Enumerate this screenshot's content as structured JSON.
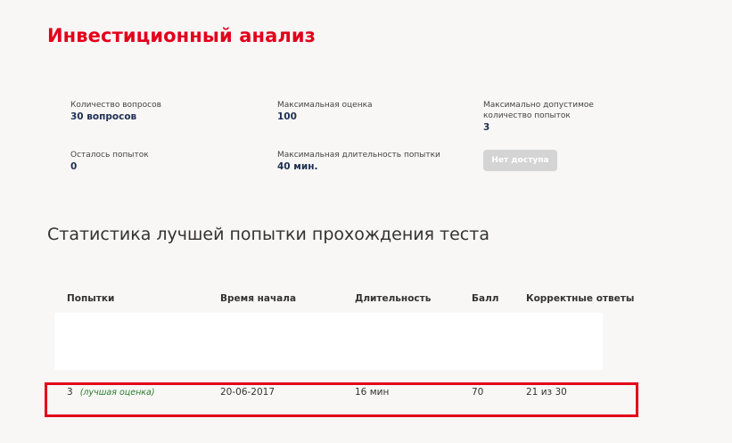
{
  "page": {
    "title": "Инвестиционный анализ"
  },
  "info": {
    "questions_label": "Количество вопросов",
    "questions_value": "30 вопросов",
    "max_score_label": "Максимальная оценка",
    "max_score_value": "100",
    "max_attempts_label": "Максимально допустимое количество попыток",
    "max_attempts_value": "3",
    "attempts_left_label": "Осталось попыток",
    "attempts_left_value": "0",
    "max_duration_label": "Максимальная длительность попытки",
    "max_duration_value": "40 мин."
  },
  "actions": {
    "no_access_label": "Нет доступа"
  },
  "stats": {
    "title": "Статистика лучшей попытки прохождения теста",
    "columns": [
      "Попытки",
      "Время начала",
      "Длительность",
      "Балл",
      "Корректные ответы"
    ],
    "rows": [
      {
        "attempt": "3",
        "note": "(лучшая оценка)",
        "start_time": "20-06-2017",
        "duration": "16 мин",
        "score": "70",
        "correct": "21 из 30"
      }
    ]
  },
  "colors": {
    "brand": "#e3001b",
    "value_text": "#1e2f52",
    "best_note": "#2d7a2d",
    "disabled_button": "#d4d4d4"
  }
}
